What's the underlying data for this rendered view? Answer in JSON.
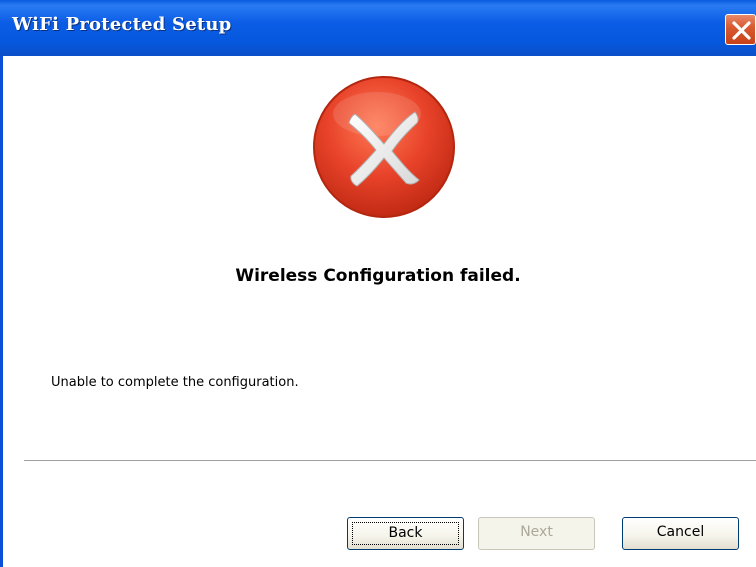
{
  "window": {
    "title": "WiFi Protected Setup",
    "close_icon": "close-x-icon",
    "title_color": "#0558dd"
  },
  "status": {
    "icon": "error-x-icon",
    "icon_color": "#e8432a",
    "headline": "Wireless Configuration failed.",
    "message": "Unable to complete the configuration."
  },
  "buttons": {
    "back": "Back",
    "next": "Next",
    "cancel": "Cancel",
    "next_disabled": true
  }
}
